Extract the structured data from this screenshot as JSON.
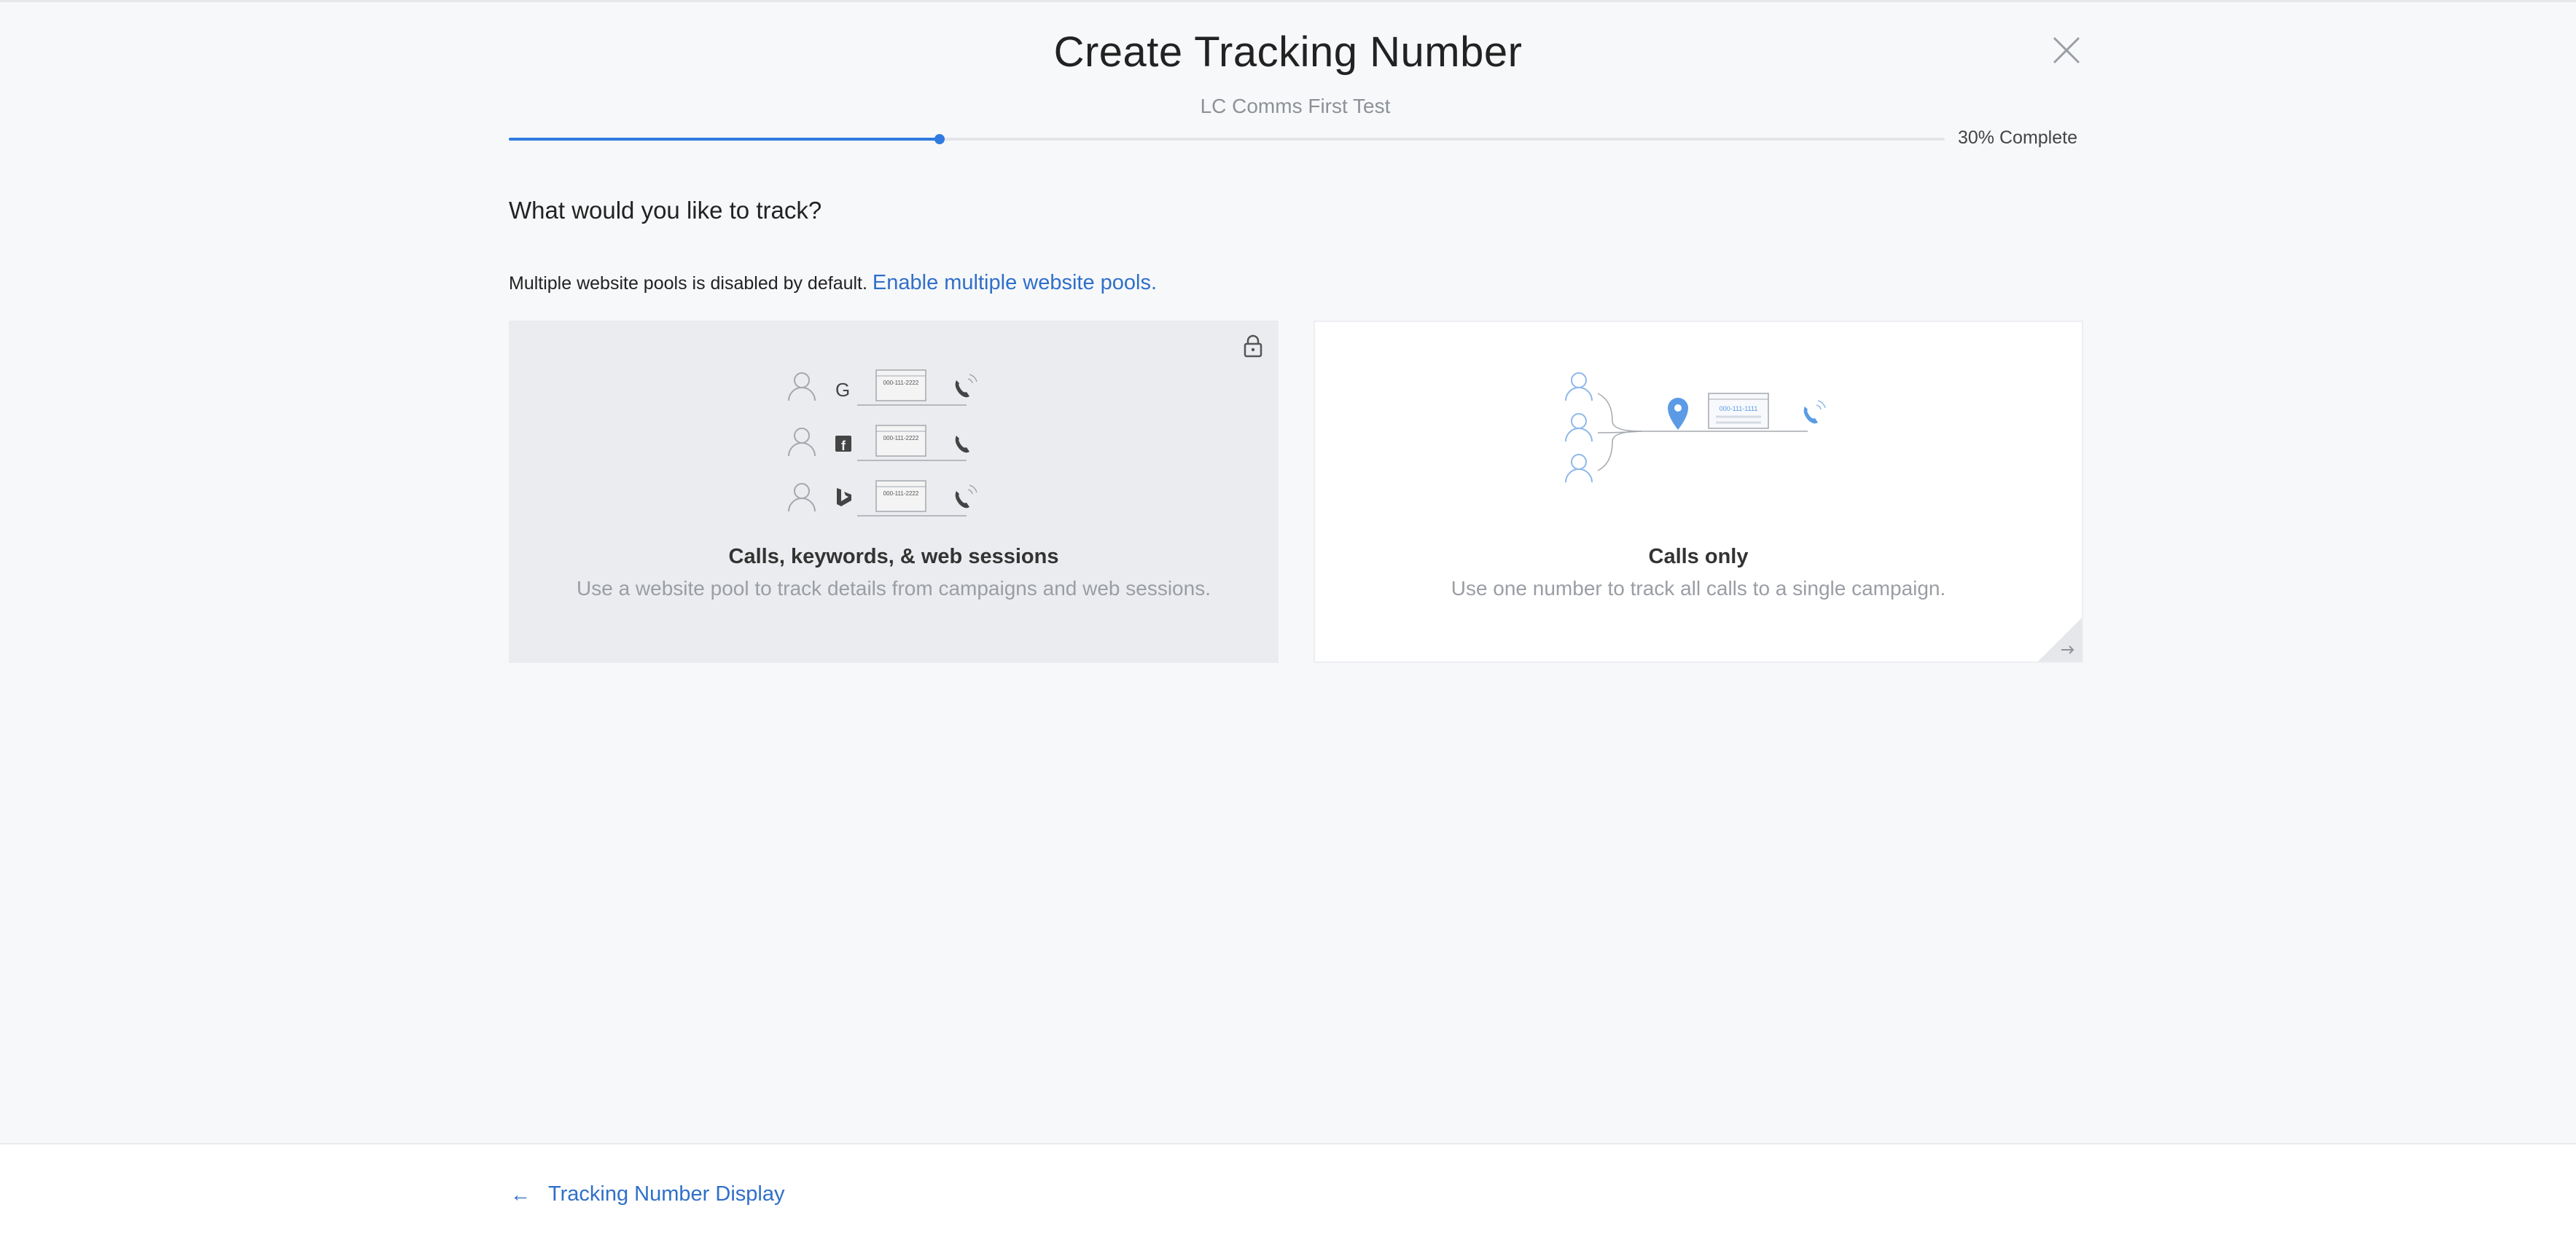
{
  "header": {
    "title": "Create Tracking Number",
    "subtitle": "LC Comms First Test",
    "close_icon": "close-icon"
  },
  "progress": {
    "percent": 30,
    "label": "30% Complete"
  },
  "main": {
    "question": "What would you like to track?",
    "pools_note": "Multiple website pools is disabled by default.",
    "pools_link": "Enable multiple website pools."
  },
  "cards": [
    {
      "title": "Calls, keywords, & web sessions",
      "description": "Use a website pool to track details from campaigns and web sessions.",
      "locked": true,
      "icon": "lock-icon",
      "illustration_number": "000-111-2222",
      "sources": [
        "google-icon",
        "facebook-icon",
        "bing-icon"
      ]
    },
    {
      "title": "Calls only",
      "description": "Use one number to track all calls to a single campaign.",
      "locked": false,
      "icon": "arrow-right-icon",
      "illustration_number": "000-111-1111"
    }
  ],
  "colors": {
    "accent": "#2f7be0",
    "link": "#2f6fc9",
    "background": "#f7f8fa"
  },
  "footer": {
    "back_label": "Tracking Number Display",
    "back_icon": "arrow-left-icon"
  }
}
